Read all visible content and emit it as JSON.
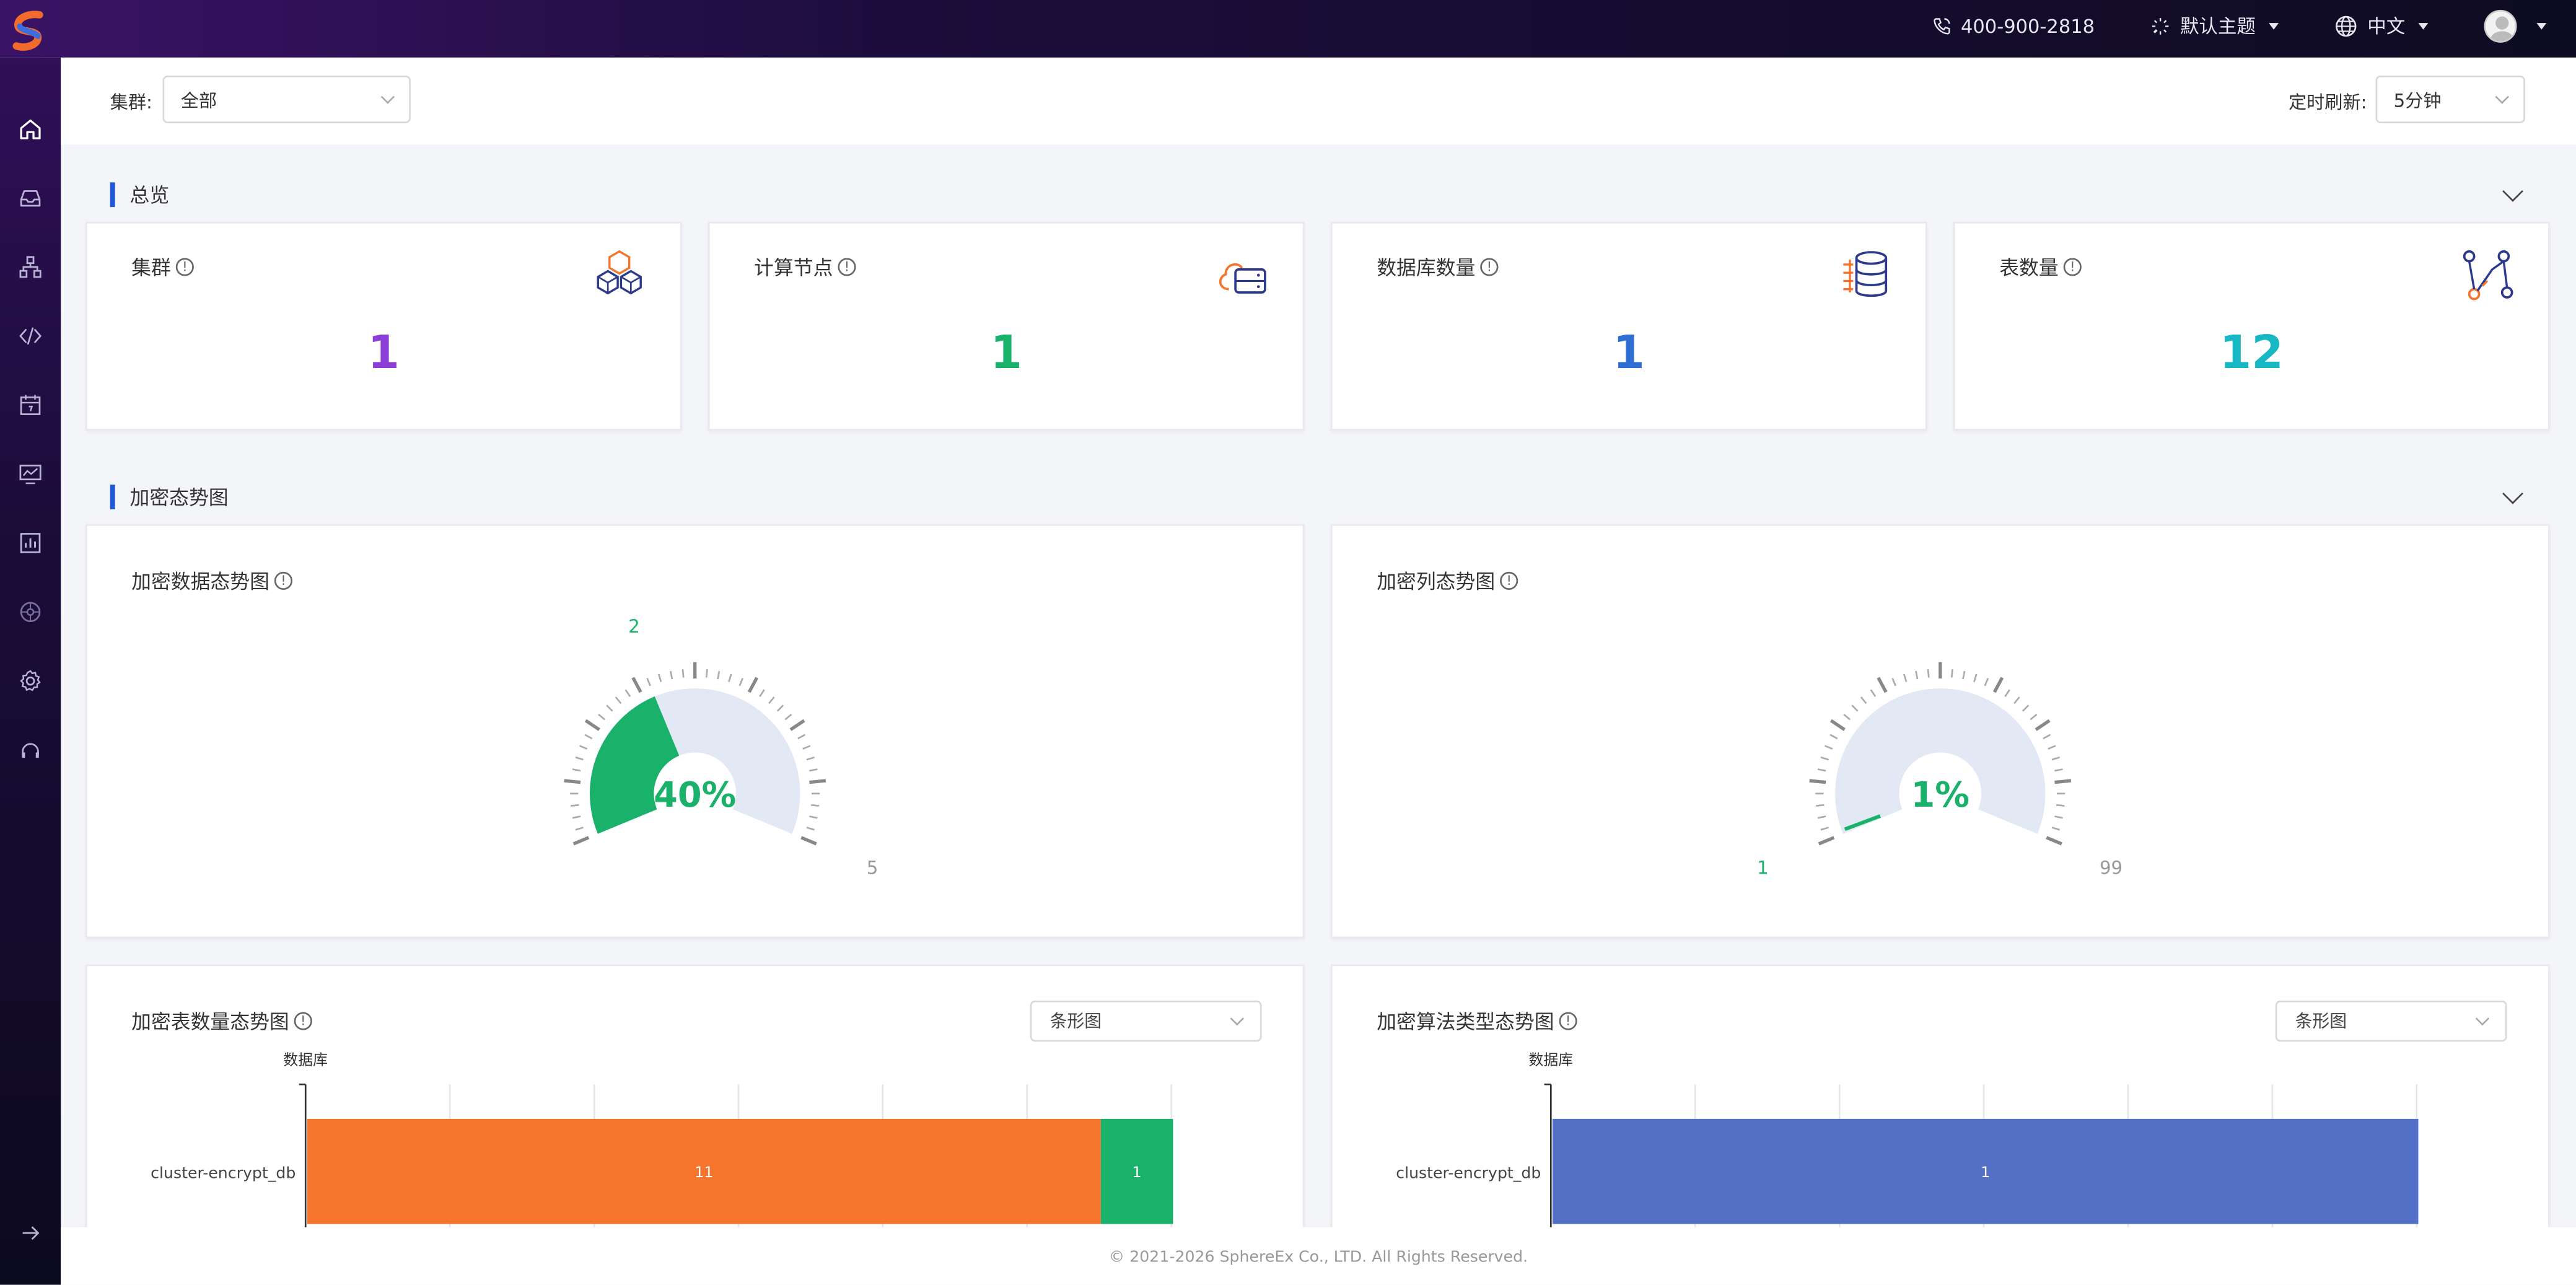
{
  "header": {
    "phone": "400-900-2818",
    "theme_label": "默认主题",
    "language_label": "中文"
  },
  "filters": {
    "cluster_label": "集群:",
    "cluster_value": "全部",
    "refresh_label": "定时刷新:",
    "refresh_value": "5分钟"
  },
  "overview": {
    "section_title": "总览",
    "cards": [
      {
        "title": "集群",
        "value": "1",
        "color": "#8b3fd6",
        "icon": "cubes-icon"
      },
      {
        "title": "计算节点",
        "value": "1",
        "color": "#1ab26b",
        "icon": "cloud-server-icon"
      },
      {
        "title": "数据库数量",
        "value": "1",
        "color": "#2f6fd3",
        "icon": "database-icon"
      },
      {
        "title": "表数量",
        "value": "12",
        "color": "#17b7c4",
        "icon": "branch-icon"
      }
    ]
  },
  "encryption": {
    "section_title": "加密态势图",
    "data_gauge": {
      "title": "加密数据态势图",
      "percent_label": "40%",
      "percent": 40,
      "encrypted_label": "2",
      "total_label": "5",
      "color": "#1ab26b"
    },
    "column_gauge": {
      "title": "加密列态势图",
      "percent_label": "1%",
      "percent": 1,
      "encrypted_label": "1",
      "total_label": "99",
      "color": "#1ab26b"
    },
    "table_chart": {
      "title": "加密表数量态势图",
      "chart_type_value": "条形图",
      "axis_label": "数据库",
      "category": "cluster-encrypt_db",
      "segments": [
        {
          "value": 11,
          "label": "11",
          "color": "#f5752e"
        },
        {
          "value": 1,
          "label": "1",
          "color": "#1ab26b"
        }
      ]
    },
    "algorithm_chart": {
      "title": "加密算法类型态势图",
      "chart_type_value": "条形图",
      "axis_label": "数据库",
      "category": "cluster-encrypt_db",
      "segments": [
        {
          "value": 1,
          "label": "1",
          "color": "#5470c6"
        }
      ]
    }
  },
  "chart_data": [
    {
      "type": "bar",
      "title": "加密表数量态势图",
      "ylabel": "数据库",
      "categories": [
        "cluster-encrypt_db"
      ],
      "series": [
        {
          "values": [
            11
          ]
        },
        {
          "values": [
            1
          ]
        }
      ],
      "stacked": true,
      "orientation": "horizontal"
    },
    {
      "type": "bar",
      "title": "加密算法类型态势图",
      "ylabel": "数据库",
      "categories": [
        "cluster-encrypt_db"
      ],
      "series": [
        {
          "values": [
            1
          ]
        }
      ],
      "orientation": "horizontal"
    }
  ],
  "footer": {
    "copyright": "© 2021-2026 SphereEx Co., LTD. All Rights Reserved."
  }
}
